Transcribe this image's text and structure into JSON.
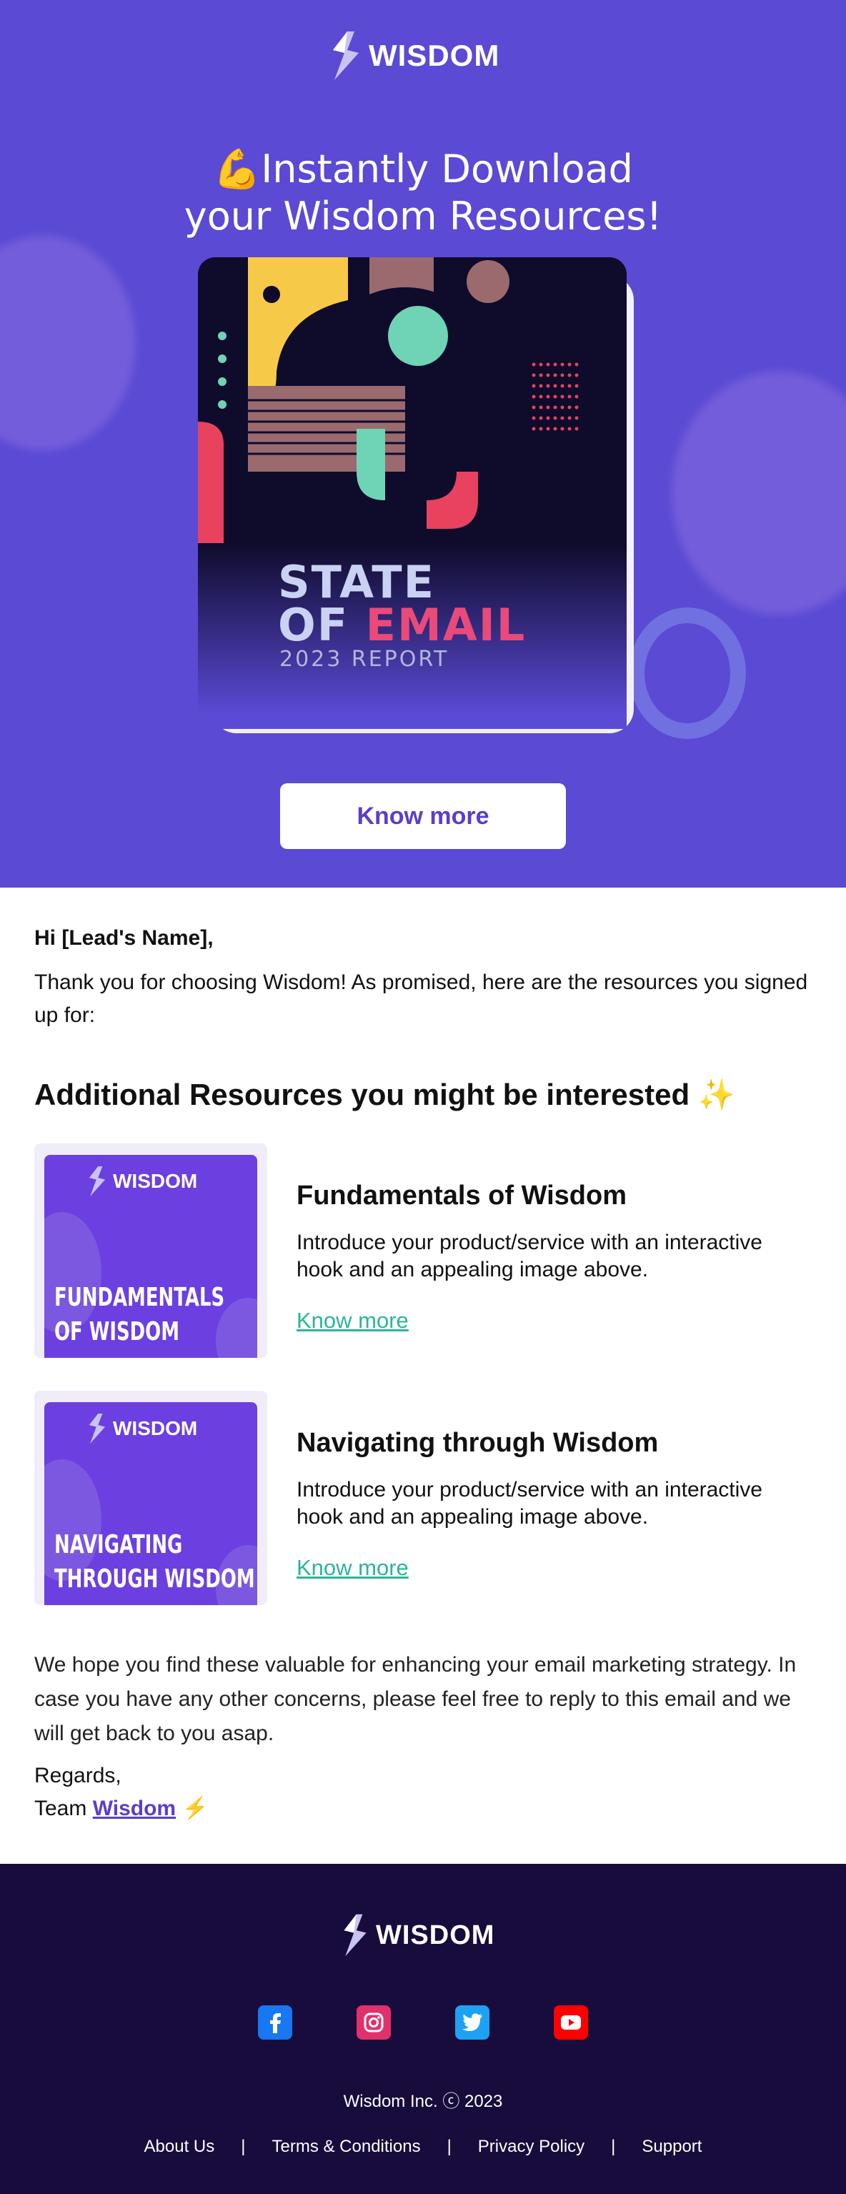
{
  "brand": {
    "name": "WISDOM"
  },
  "hero": {
    "title_line1": "💪Instantly Download",
    "title_line2": "your Wisdom Resources!",
    "report_line1": "STATE",
    "report_line2a": "OF ",
    "report_line2b": "EMAIL",
    "report_sub": "2023 REPORT",
    "cta_label": "Know more"
  },
  "body": {
    "greeting": "Hi [Lead's Name],",
    "intro": "Thank you for choosing Wisdom! As promised, here are the resources you signed up for:",
    "section_heading": "Additional Resources you might be interested ✨",
    "resources": [
      {
        "thumb_line1": "FUNDAMENTALS",
        "thumb_line2": "OF WISDOM",
        "title": "Fundamentals of Wisdom",
        "description": "Introduce your product/service with an interactive hook and an appealing image above.",
        "link_label": "Know more"
      },
      {
        "thumb_line1": "NAVIGATING",
        "thumb_line2": "THROUGH WISDOM",
        "title": "Navigating through Wisdom",
        "description": "Introduce your product/service with an interactive hook and an appealing image above.",
        "link_label": "Know more"
      }
    ],
    "closing": "We hope you find these valuable for enhancing your email marketing strategy. In case you have any other concerns, please feel free to reply to this email and we will get back to you asap.",
    "regards": "Regards,",
    "team_prefix": "Team ",
    "team_link": "Wisdom",
    "team_suffix": " ⚡"
  },
  "footer": {
    "social": [
      {
        "icon": "facebook-icon",
        "color": "#1877f2"
      },
      {
        "icon": "instagram-icon",
        "color": "#e1306c"
      },
      {
        "icon": "twitter-icon",
        "color": "#1da1f2"
      },
      {
        "icon": "youtube-icon",
        "color": "#ff0000"
      }
    ],
    "copyright": "Wisdom Inc. ⓒ 2023",
    "links": [
      "About Us",
      "Terms & Conditions",
      "Privacy Policy",
      "Support"
    ],
    "separator": "|"
  },
  "colors": {
    "hero_bg": "#5a4ad4",
    "footer_bg": "#170c3b",
    "link_green": "#2cb59a",
    "brand_purple": "#5b3ec9"
  }
}
